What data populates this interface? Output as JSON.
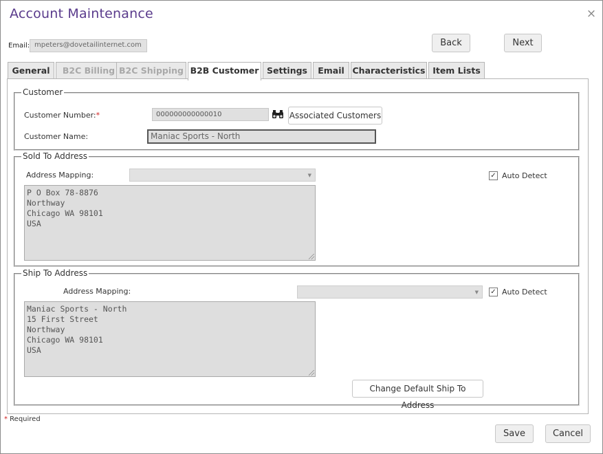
{
  "window": {
    "title": "Account Maintenance",
    "close_glyph": "×"
  },
  "header": {
    "email_label": "Email:",
    "email_value": "mpeters@dovetailinternet.com",
    "back_label": "Back",
    "next_label": "Next"
  },
  "tabs": [
    {
      "label": "General",
      "state": "normal"
    },
    {
      "label": "B2C Billing",
      "state": "disabled"
    },
    {
      "label": "B2C Shipping",
      "state": "disabled"
    },
    {
      "label": "B2B Customer",
      "state": "active"
    },
    {
      "label": "Settings",
      "state": "normal"
    },
    {
      "label": "Email",
      "state": "normal"
    },
    {
      "label": "Characteristics",
      "state": "normal"
    },
    {
      "label": "Item Lists",
      "state": "normal"
    }
  ],
  "customer": {
    "legend": "Customer",
    "number_label": "Customer Number:",
    "required_mark": "*",
    "number_value": "000000000000010",
    "binoculars_icon": "binoculars-icon",
    "associated_label": "Associated Customers",
    "name_label": "Customer Name:",
    "name_value": "Maniac Sports - North"
  },
  "sold_to": {
    "legend": "Sold To Address",
    "mapping_label": "Address Mapping:",
    "mapping_value": "",
    "auto_detect_label": "Auto Detect",
    "auto_detect_mark": "✓",
    "address_text": "P O Box 78-8876\nNorthway\nChicago WA 98101\nUSA"
  },
  "ship_to": {
    "legend": "Ship To Address",
    "mapping_label": "Address Mapping:",
    "mapping_value": "",
    "auto_detect_label": "Auto Detect",
    "auto_detect_mark": "✓",
    "address_text": "Maniac Sports - North\n15 First Street\nNorthway\nChicago WA 98101\nUSA",
    "change_label": "Change Default Ship To Address"
  },
  "footer": {
    "required_mark": "*",
    "required_text": " Required",
    "save_label": "Save",
    "cancel_label": "Cancel"
  }
}
